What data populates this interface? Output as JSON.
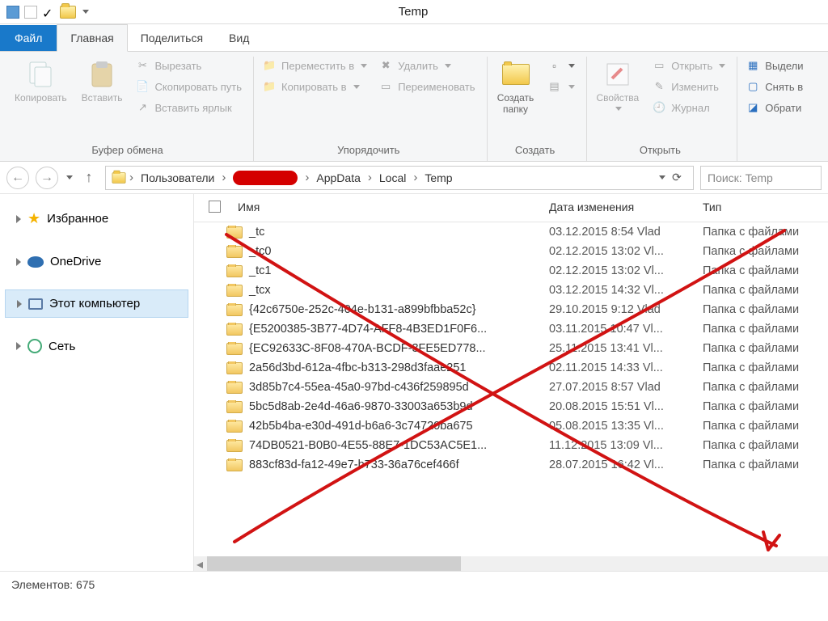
{
  "window": {
    "title": "Temp"
  },
  "tabs": {
    "file": "Файл",
    "home": "Главная",
    "share": "Поделиться",
    "view": "Вид"
  },
  "ribbon": {
    "clipboard": {
      "label": "Буфер обмена",
      "copy": "Копировать",
      "paste": "Вставить",
      "cut": "Вырезать",
      "copy_path": "Скопировать путь",
      "paste_shortcut": "Вставить ярлык"
    },
    "organize": {
      "label": "Упорядочить",
      "move_to": "Переместить в",
      "copy_to": "Копировать в",
      "delete": "Удалить",
      "rename": "Переименовать"
    },
    "new": {
      "label": "Создать",
      "new_folder": "Создать\nпапку"
    },
    "open": {
      "label": "Открыть",
      "properties": "Свойства",
      "open_btn": "Открыть",
      "edit": "Изменить",
      "history": "Журнал"
    },
    "select": {
      "select_all": "Выдели",
      "select_none": "Снять в",
      "invert": "Обрати"
    }
  },
  "breadcrumb": {
    "users": "Пользователи",
    "appdata": "AppData",
    "local": "Local",
    "temp": "Temp"
  },
  "search": {
    "placeholder": "Поиск: Temp"
  },
  "sidebar": {
    "favorites": "Избранное",
    "onedrive": "OneDrive",
    "this_pc": "Этот компьютер",
    "network": "Сеть"
  },
  "columns": {
    "name": "Имя",
    "date": "Дата изменения",
    "type": "Тип"
  },
  "type_folder": "Папка с файлами",
  "files": [
    {
      "name": "_tc",
      "date": "03.12.2015 8:54 Vlad"
    },
    {
      "name": "_tc0",
      "date": "02.12.2015 13:02 Vl..."
    },
    {
      "name": "_tc1",
      "date": "02.12.2015 13:02 Vl..."
    },
    {
      "name": "_tcx",
      "date": "03.12.2015 14:32 Vl..."
    },
    {
      "name": "{42c6750e-252c-404e-b131-a899bfbba52c}",
      "date": "29.10.2015 9:12 Vlad"
    },
    {
      "name": "{E5200385-3B77-4D74-AFF8-4B3ED1F0F6...",
      "date": "03.11.2015 10:47 Vl..."
    },
    {
      "name": "{EC92633C-8F08-470A-BCDF-3FE5ED778...",
      "date": "25.11.2015 13:41 Vl..."
    },
    {
      "name": "2a56d3bd-612a-4fbc-b313-298d3faae251",
      "date": "02.11.2015 14:33 Vl..."
    },
    {
      "name": "3d85b7c4-55ea-45a0-97bd-c436f259895d",
      "date": "27.07.2015 8:57 Vlad"
    },
    {
      "name": "5bc5d8ab-2e4d-46a6-9870-33003a653b9d",
      "date": "20.08.2015 15:51 Vl..."
    },
    {
      "name": "42b5b4ba-e30d-491d-b6a6-3c74720ba675",
      "date": "05.08.2015 13:35 Vl..."
    },
    {
      "name": "74DB0521-B0B0-4E55-88E7-1DC53AC5E1...",
      "date": "11.12.2015 13:09 Vl..."
    },
    {
      "name": "883cf83d-fa12-49e7-b733-36a76cef466f",
      "date": "28.07.2015 16:42 Vl..."
    }
  ],
  "status": {
    "count_label": "Элементов:",
    "count": "675"
  },
  "annotation": {
    "color": "#d11313"
  }
}
